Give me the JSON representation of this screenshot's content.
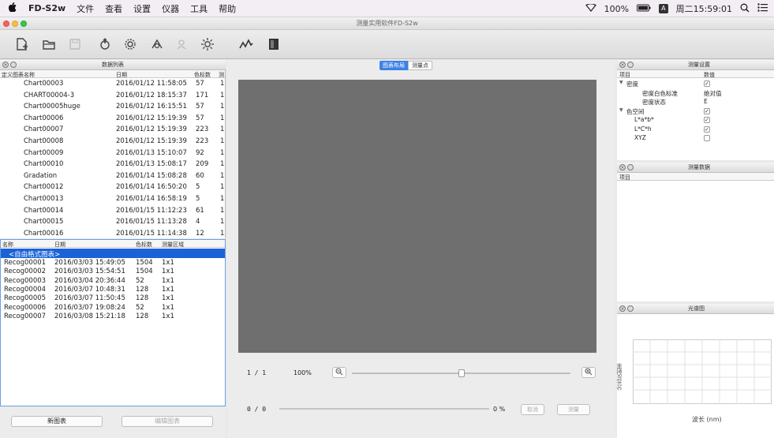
{
  "menubar": {
    "apple": "",
    "app": "FD-S2w",
    "menus": [
      "文件",
      "查看",
      "设置",
      "仪器",
      "工具",
      "帮助"
    ],
    "battery": "100%",
    "datetime": "周二15:59:01"
  },
  "window": {
    "title": "测量实用软件FD-S2w"
  },
  "chart_list": {
    "title": "数据列表",
    "col_name": "定义图表名称",
    "col_date": "日期",
    "col_count": "色标数",
    "col_extra": "测",
    "rows": [
      {
        "name": "Chart00003",
        "date": "2016/01/12 11:58:05",
        "count": "57",
        "x": "1"
      },
      {
        "name": "CHART00004-3",
        "date": "2016/01/12 18:15:37",
        "count": "171",
        "x": "1"
      },
      {
        "name": "Chart00005huge",
        "date": "2016/01/12 16:15:51",
        "count": "57",
        "x": "1"
      },
      {
        "name": "Chart00006",
        "date": "2016/01/12 15:19:39",
        "count": "57",
        "x": "1"
      },
      {
        "name": "Chart00007",
        "date": "2016/01/12 15:19:39",
        "count": "223",
        "x": "1"
      },
      {
        "name": "Chart00008",
        "date": "2016/01/12 15:19:39",
        "count": "223",
        "x": "1"
      },
      {
        "name": "Chart00009",
        "date": "2016/01/13 15:10:07",
        "count": "92",
        "x": "1"
      },
      {
        "name": "Chart00010",
        "date": "2016/01/13 15:08:17",
        "count": "209",
        "x": "1"
      },
      {
        "name": "Gradation",
        "date": "2016/01/14 15:08:28",
        "count": "60",
        "x": "1"
      },
      {
        "name": "Chart00012",
        "date": "2016/01/14 16:50:20",
        "count": "5",
        "x": "1"
      },
      {
        "name": "Chart00013",
        "date": "2016/01/14 16:58:19",
        "count": "5",
        "x": "1"
      },
      {
        "name": "Chart00014",
        "date": "2016/01/15 11:12:23",
        "count": "61",
        "x": "1"
      },
      {
        "name": "Chart00015",
        "date": "2016/01/15 11:13:28",
        "count": "4",
        "x": "1"
      },
      {
        "name": "Chart00016",
        "date": "2016/01/15 11:14:38",
        "count": "12",
        "x": "1"
      }
    ]
  },
  "recog_list": {
    "col_name": "名称",
    "col_date": "日期",
    "col_count": "色标数",
    "col_area": "测量区域",
    "selected": "<自由格式图表>",
    "rows": [
      {
        "name": "Recog00001",
        "date": "2016/03/03 15:49:05",
        "count": "1504",
        "area": "1x1"
      },
      {
        "name": "Recog00002",
        "date": "2016/03/03 15:54:51",
        "count": "1504",
        "area": "1x1"
      },
      {
        "name": "Recog00003",
        "date": "2016/03/04 20:36:44",
        "count": "52",
        "area": "1x1"
      },
      {
        "name": "Recog00004",
        "date": "2016/03/07 10:48:31",
        "count": "128",
        "area": "1x1"
      },
      {
        "name": "Recog00005",
        "date": "2016/03/07 11:50:45",
        "count": "128",
        "area": "1x1"
      },
      {
        "name": "Recog00006",
        "date": "2016/03/07 19:08:24",
        "count": "52",
        "area": "1x1"
      },
      {
        "name": "Recog00007",
        "date": "2016/03/08 15:21:18",
        "count": "128",
        "area": "1x1"
      }
    ],
    "new_button": "新图表",
    "edit_button": "编辑图表"
  },
  "center": {
    "tab_layout": "图表布局",
    "tab_points": "测量点",
    "page": "1 / 1",
    "zoom": "100%",
    "progress_count": "0 / 0",
    "progress_pct": "0 %",
    "cancel": "取消",
    "measure": "测量",
    "zoom_level": 0.5
  },
  "settings": {
    "title": "测量设置",
    "col_item": "项目",
    "col_value": "数值",
    "rows": [
      {
        "indent": 0,
        "arrow": "▼",
        "label": "密度",
        "value": "✓",
        "type": "check"
      },
      {
        "indent": 2,
        "arrow": "",
        "label": "密度白色标准",
        "value": "绝对值",
        "type": "text"
      },
      {
        "indent": 2,
        "arrow": "",
        "label": "密度状态",
        "value": "E",
        "type": "text"
      },
      {
        "indent": 0,
        "arrow": "▼",
        "label": "色空间",
        "value": "✓",
        "type": "check"
      },
      {
        "indent": 1,
        "arrow": "",
        "label": "L*a*b*",
        "value": "✓",
        "type": "check"
      },
      {
        "indent": 1,
        "arrow": "",
        "label": "L*C*h",
        "value": "✓",
        "type": "check"
      },
      {
        "indent": 1,
        "arrow": "",
        "label": "XYZ",
        "value": "",
        "type": "check"
      }
    ]
  },
  "measure_data": {
    "title": "测量数据",
    "col_item": "项目"
  },
  "spectrum": {
    "title": "光谱图",
    "ylabel": "分光反射率",
    "xlabel": "波长 (nm)"
  }
}
